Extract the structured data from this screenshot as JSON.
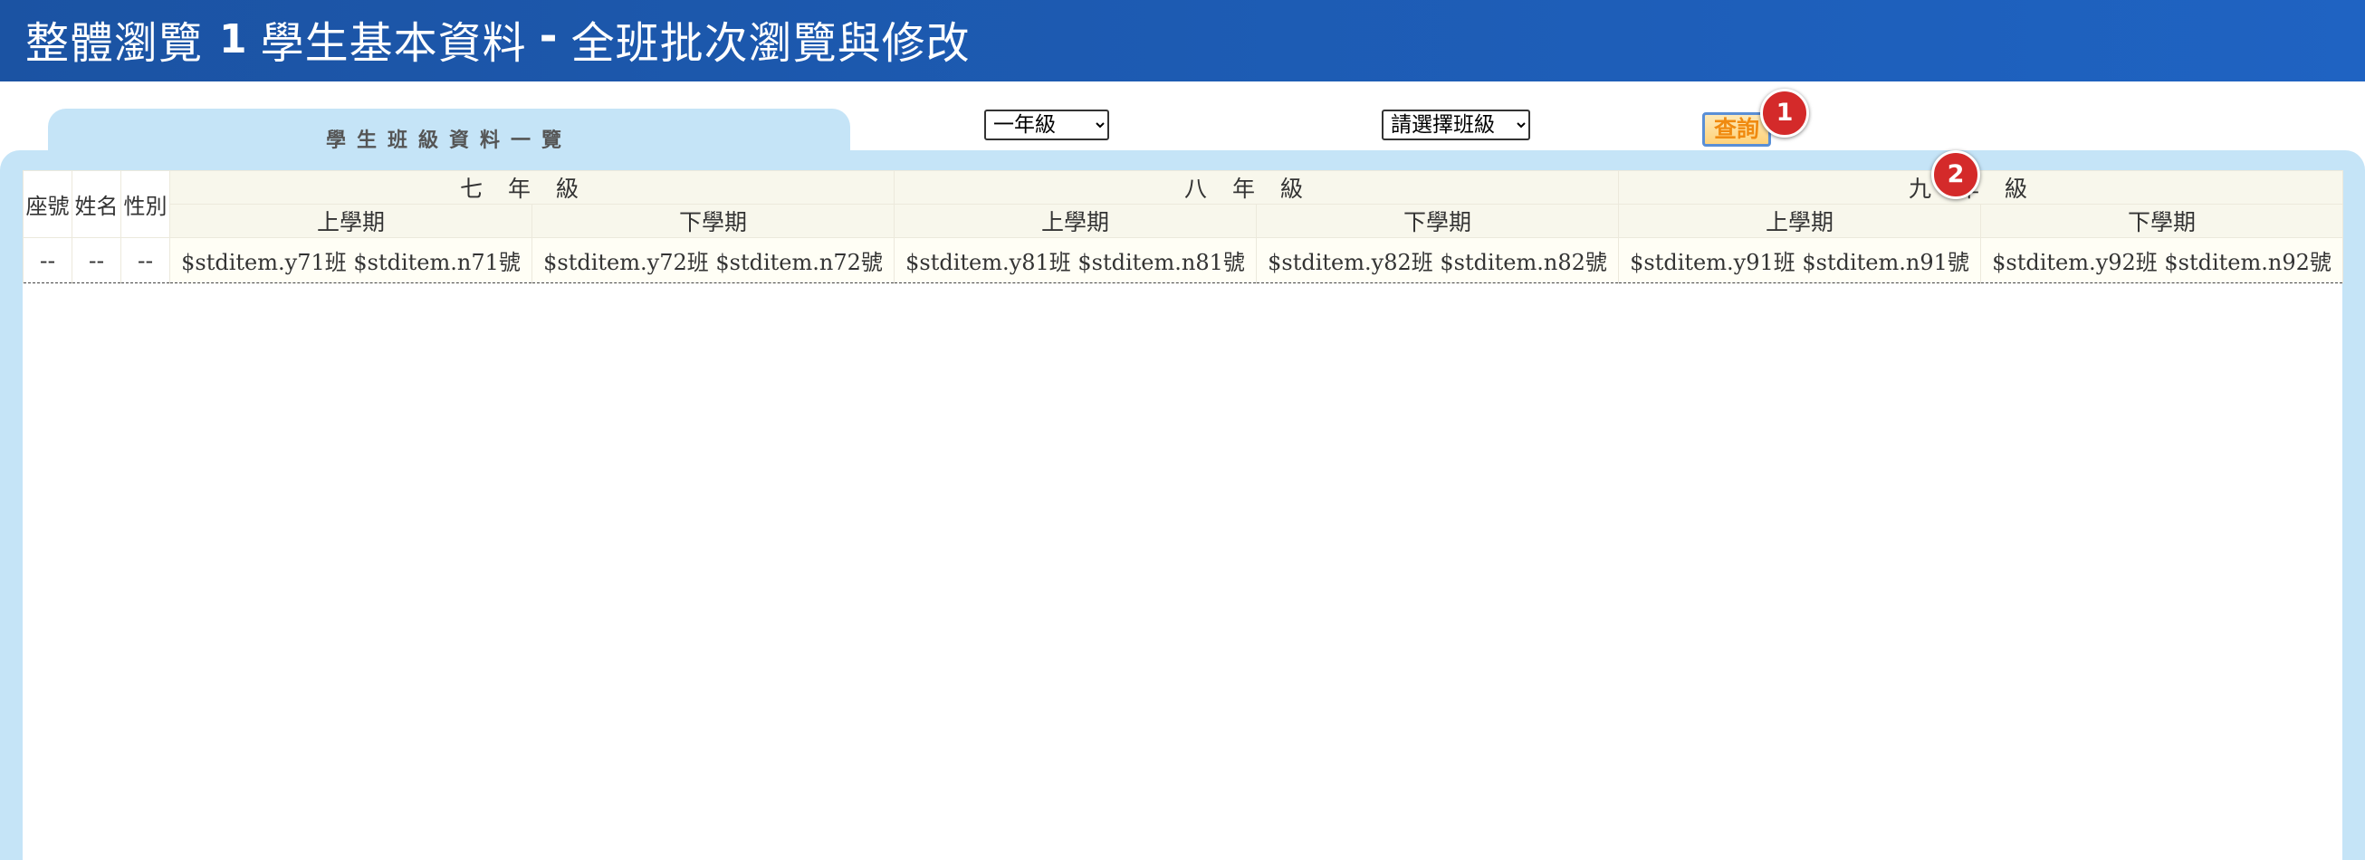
{
  "header": {
    "title_main": "整體瀏覽",
    "step_number": "1",
    "dash": "-",
    "title_sub": "學生基本資料",
    "title_suffix": "全班批次瀏覽與修改"
  },
  "tab": {
    "label": "學生班級資料一覽"
  },
  "filters": {
    "grade_selected": "一年級",
    "class_selected": "請選擇班級"
  },
  "query_button": {
    "label": "查詢"
  },
  "badges": [
    "1",
    "2"
  ],
  "table": {
    "left_headers": [
      "座號",
      "姓名",
      "性別"
    ],
    "grades": [
      "七年級",
      "八年級",
      "九年級"
    ],
    "semesters": [
      "上學期",
      "下學期",
      "上學期",
      "下學期",
      "上學期",
      "下學期"
    ],
    "row": {
      "seat": "--",
      "name": "--",
      "gender": "--",
      "cells": [
        "$stditem.y71班 $stditem.n71號",
        "$stditem.y72班 $stditem.n72號",
        "$stditem.y81班 $stditem.n81號",
        "$stditem.y82班 $stditem.n82號",
        "$stditem.y91班 $stditem.n91號",
        "$stditem.y92班 $stditem.n92號"
      ]
    }
  },
  "colors": {
    "header_bg": "#1f5fba",
    "panel_bg": "#c5e4f7",
    "badge": "#d42a2a",
    "query_text": "#f08a10"
  }
}
